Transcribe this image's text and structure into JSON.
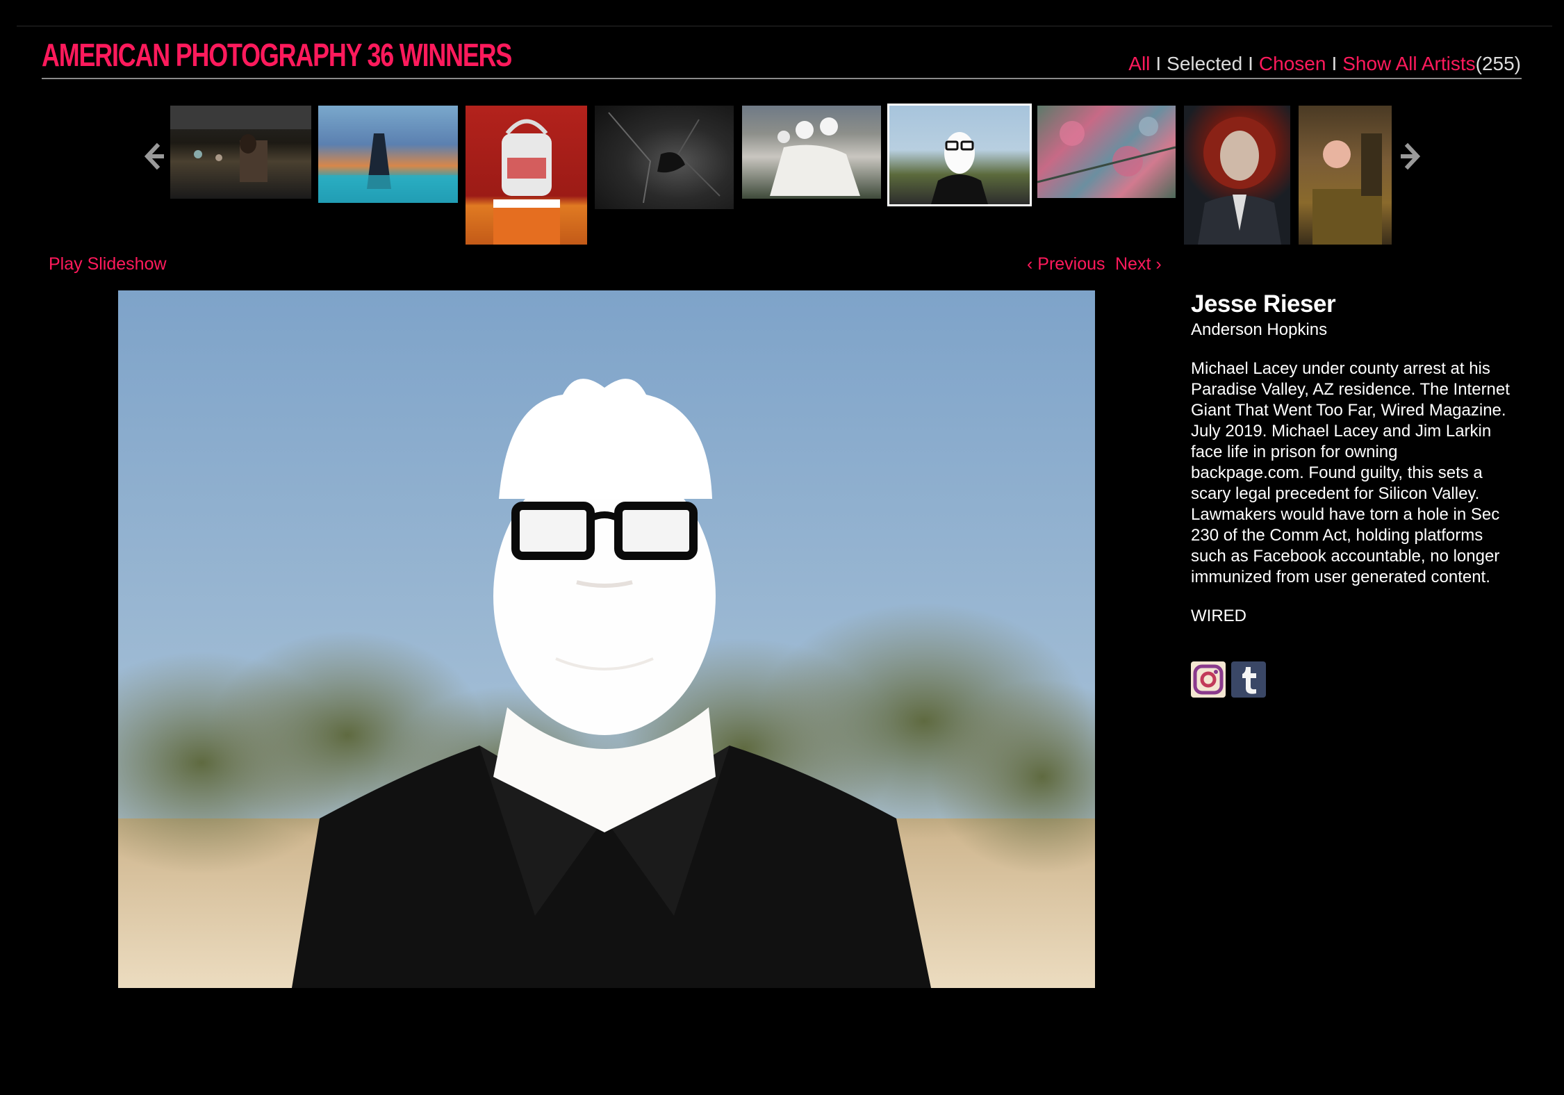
{
  "header": {
    "title": "AMERICAN PHOTOGRAPHY 36 WINNERS",
    "filters": {
      "all": "All",
      "separator": "I",
      "selected": "Selected",
      "chosen": "Chosen",
      "show_all_artists": "Show All Artists",
      "count": "(255)"
    }
  },
  "carousel": {
    "prev_icon": "chevron-left-icon",
    "next_icon": "chevron-right-icon",
    "active_index": 5
  },
  "controls": {
    "play_slideshow": "Play Slideshow",
    "previous": "‹ Previous",
    "next": "Next ›"
  },
  "entry": {
    "artist": "Jesse Rieser",
    "subject": "Anderson Hopkins",
    "description": "Michael Lacey under county arrest at his Paradise Valley, AZ residence. The Internet Giant That Went Too Far, Wired Magazine. July 2019. Michael Lacey and Jim Larkin face life in prison for owning backpage.com. Found guilty, this sets a scary legal precedent for Silicon Valley. Lawmakers would have torn a hole in Sec 230 of the Comm Act, holding platforms such as Facebook accountable, no longer immunized from user generated content.",
    "client": "WIRED"
  },
  "social": {
    "icons": [
      "instagram-icon",
      "tumblr-icon"
    ]
  },
  "colors": {
    "accent": "#ff1a5c",
    "background": "#000000",
    "muted_text": "#dddddd"
  }
}
